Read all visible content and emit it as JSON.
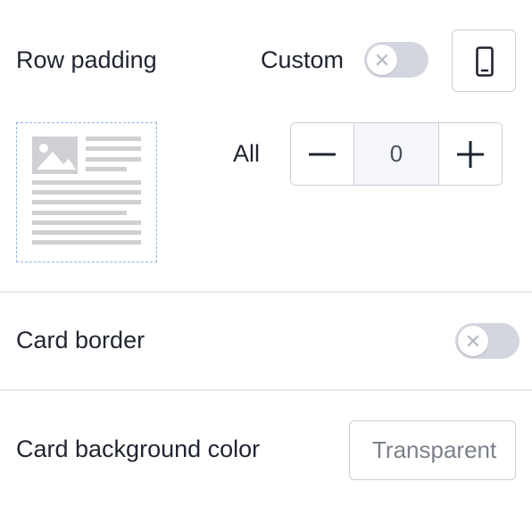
{
  "row_padding": {
    "label": "Row padding",
    "custom_label": "Custom",
    "custom_toggle": "off",
    "device_icon": "mobile-phone-icon",
    "all_label": "All",
    "value": "0",
    "decrement_icon": "minus-icon",
    "increment_icon": "plus-icon",
    "preview_icon": "layout-preview-icon"
  },
  "card_border": {
    "label": "Card border",
    "toggle": "off"
  },
  "card_background": {
    "label": "Card background color",
    "value": "Transparent"
  },
  "colors": {
    "toggle_track": "#d3d6df",
    "preview_border": "#8fb6e8",
    "field_border": "#c8ccd6",
    "stepper_value_bg": "#f4f6fb"
  }
}
